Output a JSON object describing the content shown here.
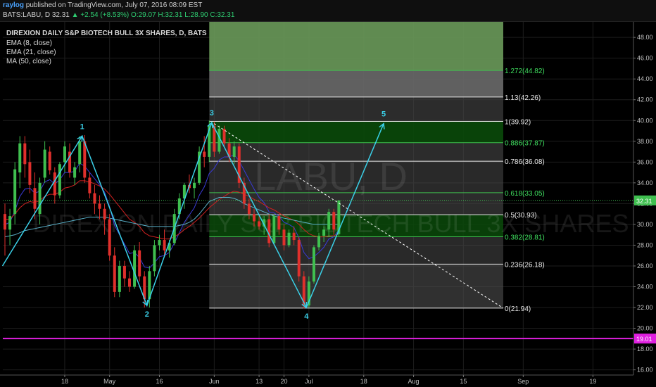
{
  "header": {
    "user": "raylog",
    "published_text": "published on TradingView.com, July 07, 2016 08:09 EST",
    "symbol_line": "BATS:LABU, D  32.31",
    "change": "▲ +2.54 (+8.53%)",
    "ohlc": "O:29.07  H:32.31  L:28.90  C:32.31"
  },
  "legend": {
    "title": "DIREXION DAILY S&P BIOTECH BULL 3X SHARES, D, BATS",
    "studies": [
      "EMA (8, close)",
      "EMA (21, close)",
      "MA (50, close)"
    ]
  },
  "watermark": {
    "symbol": "LABU, D",
    "name": "DIREXION DAILY S&P BIOTECH BULL 3X SHARES"
  },
  "colors": {
    "bull": "#3fbf4f",
    "bear": "#e0302c",
    "pattern": "#3ad0e8",
    "fib_fill_dark": "#0a4a0a",
    "fib_fill_grey": "#4a4a4a",
    "ext_fill": "#6a9a5a",
    "ema_fast": "#3a3ad8",
    "ema_slow": "#d02020",
    "ma": "#5ab0c8",
    "support": "#e020e0"
  },
  "chart_data": {
    "type": "candlestick",
    "symbol": "BATS:LABU",
    "timeframe": "D",
    "y_axis": {
      "range": [
        15.5,
        49.5
      ],
      "ticks": [
        "16.00",
        "18.00",
        "20.00",
        "22.00",
        "24.00",
        "26.00",
        "28.00",
        "30.00",
        "32.00",
        "34.00",
        "36.00",
        "38.00",
        "40.00",
        "42.00",
        "44.00",
        "46.00",
        "48.00"
      ]
    },
    "x_axis": {
      "ticks": [
        {
          "label": "18",
          "index": 12
        },
        {
          "label": "May",
          "index": 21
        },
        {
          "label": "16",
          "index": 31
        },
        {
          "label": "Jun",
          "index": 42
        },
        {
          "label": "13",
          "index": 51
        },
        {
          "label": "20",
          "index": 56
        },
        {
          "label": "Jul",
          "index": 61
        },
        {
          "label": "18",
          "index": 72
        },
        {
          "label": "Aug",
          "index": 82
        },
        {
          "label": "15",
          "index": 92
        },
        {
          "label": "Sep",
          "index": 104
        },
        {
          "label": "19",
          "index": 118
        }
      ]
    },
    "candles": [
      [
        31.0,
        32.0,
        27.0,
        29.5
      ],
      [
        29.5,
        31.5,
        28.0,
        30.8
      ],
      [
        31.0,
        36.0,
        30.0,
        35.3
      ],
      [
        35.0,
        38.5,
        33.5,
        37.8
      ],
      [
        37.8,
        38.5,
        34.5,
        35.8
      ],
      [
        36.0,
        37.2,
        33.0,
        33.8
      ],
      [
        33.5,
        35.0,
        30.5,
        31.5
      ],
      [
        31.0,
        34.5,
        30.0,
        34.0
      ],
      [
        34.5,
        38.0,
        34.0,
        37.2
      ],
      [
        37.0,
        37.5,
        34.8,
        35.2
      ],
      [
        35.0,
        35.5,
        32.0,
        32.8
      ],
      [
        32.8,
        36.0,
        32.5,
        35.8
      ],
      [
        36.0,
        38.0,
        35.0,
        37.5
      ],
      [
        37.0,
        37.8,
        34.5,
        35.0
      ],
      [
        34.5,
        36.0,
        33.8,
        35.5
      ],
      [
        35.8,
        38.5,
        35.0,
        38.0
      ],
      [
        38.0,
        38.6,
        34.0,
        34.5
      ],
      [
        34.5,
        35.0,
        32.5,
        33.0
      ],
      [
        33.0,
        33.8,
        31.0,
        32.0
      ],
      [
        32.0,
        32.8,
        30.5,
        31.5
      ],
      [
        31.5,
        32.0,
        29.0,
        30.5
      ],
      [
        30.5,
        31.0,
        26.5,
        27.0
      ],
      [
        27.0,
        27.8,
        23.0,
        23.5
      ],
      [
        23.5,
        26.5,
        23.0,
        26.0
      ],
      [
        26.0,
        26.5,
        24.0,
        24.8
      ],
      [
        24.8,
        25.5,
        23.5,
        24.0
      ],
      [
        24.0,
        28.0,
        23.8,
        27.5
      ],
      [
        27.5,
        28.3,
        24.5,
        25.0
      ],
      [
        25.0,
        25.5,
        22.0,
        22.8
      ],
      [
        22.8,
        26.0,
        22.0,
        25.5
      ],
      [
        25.5,
        28.5,
        25.0,
        28.0
      ],
      [
        28.0,
        29.0,
        27.5,
        28.5
      ],
      [
        28.5,
        29.5,
        27.0,
        27.5
      ],
      [
        27.5,
        28.5,
        26.8,
        28.2
      ],
      [
        28.2,
        31.5,
        28.0,
        31.0
      ],
      [
        31.0,
        33.0,
        30.5,
        32.5
      ],
      [
        32.5,
        34.0,
        31.5,
        33.8
      ],
      [
        33.8,
        34.8,
        33.0,
        33.5
      ],
      [
        33.5,
        34.5,
        32.5,
        34.0
      ],
      [
        34.0,
        37.5,
        33.8,
        37.0
      ],
      [
        37.0,
        38.5,
        35.5,
        36.5
      ],
      [
        36.5,
        40.0,
        36.0,
        39.5
      ],
      [
        39.5,
        39.9,
        36.5,
        37.0
      ],
      [
        37.0,
        39.5,
        36.8,
        39.2
      ],
      [
        39.2,
        39.5,
        37.5,
        37.8
      ],
      [
        37.8,
        38.3,
        36.0,
        36.5
      ],
      [
        36.5,
        38.0,
        35.8,
        37.5
      ],
      [
        37.5,
        37.8,
        33.5,
        34.0
      ],
      [
        34.0,
        34.5,
        31.5,
        32.0
      ],
      [
        32.0,
        32.5,
        30.5,
        31.0
      ],
      [
        31.0,
        31.5,
        29.8,
        30.3
      ],
      [
        30.3,
        31.0,
        29.5,
        29.8
      ],
      [
        29.8,
        30.8,
        29.0,
        30.5
      ],
      [
        30.5,
        31.0,
        27.8,
        28.2
      ],
      [
        28.2,
        31.0,
        28.0,
        30.8
      ],
      [
        30.8,
        31.0,
        29.0,
        29.5
      ],
      [
        29.5,
        30.0,
        27.5,
        28.0
      ],
      [
        28.0,
        29.5,
        27.8,
        29.2
      ],
      [
        29.2,
        29.8,
        28.0,
        28.5
      ],
      [
        28.5,
        28.8,
        24.5,
        25.0
      ],
      [
        25.0,
        25.5,
        21.9,
        22.2
      ],
      [
        22.2,
        25.0,
        22.0,
        24.5
      ],
      [
        24.5,
        28.0,
        24.3,
        27.8
      ],
      [
        27.8,
        29.2,
        27.5,
        28.9
      ],
      [
        28.9,
        29.8,
        28.3,
        29.5
      ],
      [
        29.5,
        31.5,
        28.8,
        31.2
      ],
      [
        31.2,
        31.5,
        29.0,
        29.5
      ],
      [
        29.07,
        32.31,
        28.9,
        32.31
      ]
    ],
    "indicators": [
      {
        "name": "EMA (8, close)",
        "values": [
          30.0,
          30.2,
          31.3,
          32.7,
          33.4,
          33.5,
          33.0,
          33.2,
          34.1,
          34.3,
          33.9,
          34.3,
          35.0,
          35.0,
          35.1,
          35.9,
          35.6,
          35.0,
          34.4,
          33.8,
          33.1,
          31.7,
          29.9,
          29.0,
          28.1,
          27.2,
          27.3,
          26.8,
          25.9,
          25.8,
          26.3,
          26.9,
          27.0,
          27.3,
          28.2,
          29.2,
          30.2,
          30.9,
          31.6,
          32.8,
          33.6,
          34.9,
          35.4,
          36.2,
          36.5,
          36.5,
          36.7,
          36.1,
          35.2,
          34.3,
          33.4,
          32.6,
          32.1,
          31.2,
          31.1,
          30.8,
          30.2,
          30.0,
          29.7,
          28.7,
          27.3,
          26.7,
          26.9,
          27.3,
          27.8,
          28.6,
          28.8,
          29.5
        ]
      },
      {
        "name": "EMA (21, close)",
        "values": [
          30.5,
          30.5,
          31.0,
          31.6,
          32.0,
          32.2,
          32.1,
          32.3,
          32.7,
          32.9,
          32.9,
          33.1,
          33.5,
          33.6,
          33.8,
          34.2,
          34.2,
          34.1,
          33.9,
          33.7,
          33.4,
          32.9,
          32.3,
          31.7,
          31.1,
          30.5,
          30.2,
          29.8,
          29.2,
          28.9,
          28.8,
          28.7,
          28.6,
          28.6,
          28.8,
          29.1,
          29.5,
          29.8,
          30.2,
          30.6,
          31.1,
          31.6,
          32.0,
          32.4,
          32.7,
          33.0,
          33.2,
          33.1,
          32.9,
          32.7,
          32.4,
          32.2,
          31.9,
          31.6,
          31.4,
          31.1,
          30.8,
          30.6,
          30.4,
          30.0,
          29.5,
          29.1,
          28.9,
          28.8,
          28.8,
          28.9,
          28.9,
          29.1
        ]
      },
      {
        "name": "MA (50, close)",
        "values": [
          28.8,
          28.9,
          29.0,
          29.2,
          29.4,
          29.5,
          29.6,
          29.7,
          29.8,
          29.9,
          30.0,
          30.1,
          30.2,
          30.3,
          30.4,
          30.5,
          30.6,
          30.7,
          30.7,
          30.7,
          30.7,
          30.6,
          30.5,
          30.4,
          30.3,
          30.2,
          30.1,
          30.0,
          29.9,
          29.8,
          29.8,
          29.8,
          29.8,
          29.8,
          29.8,
          29.9,
          30.0,
          30.2,
          30.5,
          31.0,
          31.6,
          32.2,
          32.4,
          32.6,
          32.6,
          32.6,
          32.5,
          32.3,
          32.0,
          31.8,
          31.6,
          31.4,
          31.2,
          31.0,
          30.8,
          30.7,
          30.6,
          30.5,
          30.4,
          30.3,
          30.2,
          30.1,
          30.0,
          30.0,
          30.0,
          30.0,
          30.0,
          30.0
        ]
      }
    ],
    "fib_levels": [
      {
        "ratio": "0",
        "price": 21.94,
        "label": "0(21.94)"
      },
      {
        "ratio": "0.236",
        "price": 26.18,
        "label": "0.236(26.18)"
      },
      {
        "ratio": "0.382",
        "price": 28.81,
        "label": "0.382(28.81)"
      },
      {
        "ratio": "0.5",
        "price": 30.93,
        "label": "0.5(30.93)"
      },
      {
        "ratio": "0.618",
        "price": 33.05,
        "label": "0.618(33.05)"
      },
      {
        "ratio": "0.786",
        "price": 36.08,
        "label": "0.786(36.08)"
      },
      {
        "ratio": "0.886",
        "price": 37.87,
        "label": "0.886(37.87)"
      },
      {
        "ratio": "1",
        "price": 39.92,
        "label": "1(39.92)"
      },
      {
        "ratio": "1.13",
        "price": 42.26,
        "label": "1.13(42.26)"
      },
      {
        "ratio": "1.272",
        "price": 44.82,
        "label": "1.272(44.82)"
      }
    ],
    "fib_range_index": [
      41,
      100
    ],
    "pattern_points": [
      {
        "label": "",
        "index": -0.5,
        "price": 26.0
      },
      {
        "label": "1",
        "index": 15.5,
        "price": 38.5
      },
      {
        "label": "2",
        "index": 28.5,
        "price": 22.2
      },
      {
        "label": "3",
        "index": 41.5,
        "price": 39.8
      },
      {
        "label": "4",
        "index": 60.5,
        "price": 22.0
      },
      {
        "label": "5",
        "index": 76,
        "price": 39.7
      }
    ],
    "trendline": {
      "from": {
        "index": 42,
        "price": 39.7
      },
      "to": {
        "index": 100,
        "price": 21.94
      }
    },
    "support_line": {
      "price": 19.01,
      "label": "19.01"
    },
    "last_price": {
      "price": 32.31,
      "label": "32.31"
    }
  }
}
